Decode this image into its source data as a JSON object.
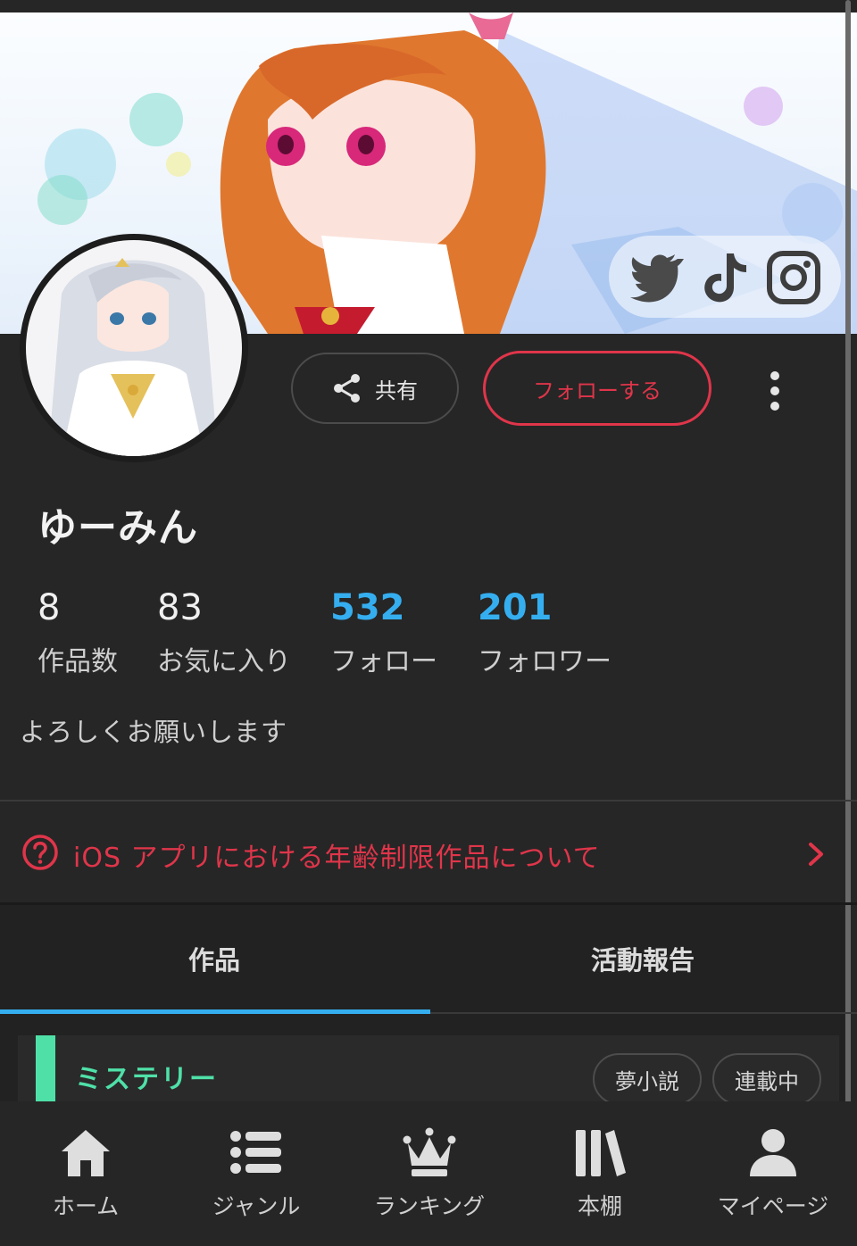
{
  "profile": {
    "username": "ゆーみん",
    "bio": "よろしくお願いします"
  },
  "social_icons": [
    "twitter-icon",
    "tiktok-icon",
    "instagram-icon"
  ],
  "actions": {
    "share_label": "共有",
    "follow_label": "フォローする"
  },
  "stats": [
    {
      "value": "8",
      "label": "作品数"
    },
    {
      "value": "83",
      "label": "お気に入り"
    },
    {
      "value": "532",
      "label": "フォロー"
    },
    {
      "value": "201",
      "label": "フォロワー"
    }
  ],
  "notice": {
    "text": "iOS アプリにおける年齢制限作品について"
  },
  "tabs": [
    {
      "label": "作品",
      "active": true
    },
    {
      "label": "活動報告",
      "active": false
    }
  ],
  "work_card": {
    "genre": "ミステリー",
    "tags": [
      "夢小説",
      "連載中"
    ]
  },
  "bottom_nav": [
    {
      "label": "ホーム",
      "icon": "home-icon"
    },
    {
      "label": "ジャンル",
      "icon": "list-icon"
    },
    {
      "label": "ランキング",
      "icon": "crown-icon"
    },
    {
      "label": "本棚",
      "icon": "bookshelf-icon"
    },
    {
      "label": "マイページ",
      "icon": "user-icon"
    }
  ],
  "colors": {
    "background": "#262626",
    "accent_red": "#e0354a",
    "accent_blue": "#35aef0",
    "genre_green": "#4fe0a8"
  }
}
